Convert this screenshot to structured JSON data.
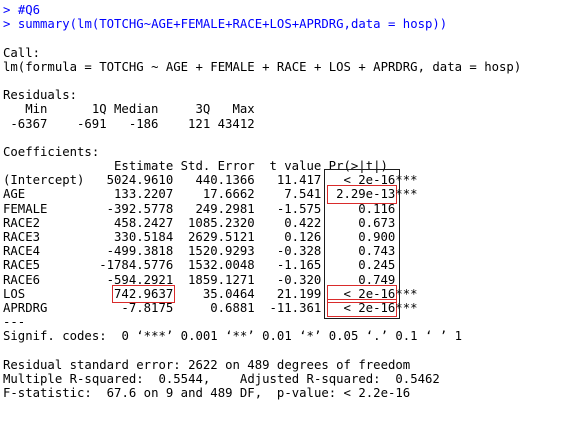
{
  "console": {
    "comment": "#Q6",
    "command": "summary(lm(TOTCHG~AGE+FEMALE+RACE+LOS+APRDRG,data = hosp))",
    "prompt_char": ">"
  },
  "call": {
    "header": "Call:",
    "formula": "lm(formula = TOTCHG ~ AGE + FEMALE + RACE + LOS + APRDRG, data = hosp)"
  },
  "residuals": {
    "header": "Residuals:",
    "labels": [
      "Min",
      "1Q",
      "Median",
      "3Q",
      "Max"
    ],
    "values": [
      "-6367",
      "-691",
      "-186",
      "121",
      "43412"
    ]
  },
  "coefficients": {
    "header": "Coefficients:",
    "columns": [
      "Estimate",
      "Std. Error",
      "t value",
      "Pr(>|t|)"
    ],
    "rows": [
      {
        "name": "(Intercept)",
        "estimate": "5024.9610",
        "se": "440.1366",
        "t": "11.417",
        "p": "< 2e-16",
        "stars": "***"
      },
      {
        "name": "AGE",
        "estimate": "133.2207",
        "se": "17.6662",
        "t": "7.541",
        "p": "2.29e-13",
        "stars": "***"
      },
      {
        "name": "FEMALE",
        "estimate": "-392.5778",
        "se": "249.2981",
        "t": "-1.575",
        "p": "0.116",
        "stars": ""
      },
      {
        "name": "RACE2",
        "estimate": "458.2427",
        "se": "1085.2320",
        "t": "0.422",
        "p": "0.673",
        "stars": ""
      },
      {
        "name": "RACE3",
        "estimate": "330.5184",
        "se": "2629.5121",
        "t": "0.126",
        "p": "0.900",
        "stars": ""
      },
      {
        "name": "RACE4",
        "estimate": "-499.3818",
        "se": "1520.9293",
        "t": "-0.328",
        "p": "0.743",
        "stars": ""
      },
      {
        "name": "RACE5",
        "estimate": "-1784.5776",
        "se": "1532.0048",
        "t": "-1.165",
        "p": "0.245",
        "stars": ""
      },
      {
        "name": "RACE6",
        "estimate": "-594.2921",
        "se": "1859.1271",
        "t": "-0.320",
        "p": "0.749",
        "stars": ""
      },
      {
        "name": "LOS",
        "estimate": "742.9637",
        "se": "35.0464",
        "t": "21.199",
        "p": "< 2e-16",
        "stars": "***"
      },
      {
        "name": "APRDRG",
        "estimate": "-7.8175",
        "se": "0.6881",
        "t": "-11.361",
        "p": "< 2e-16",
        "stars": "***"
      }
    ],
    "separator": "---",
    "signif_codes": "Signif. codes:  0 ‘***’ 0.001 ‘**’ 0.01 ‘*’ 0.05 ‘.’ 0.1 ‘ ’ 1"
  },
  "summary": {
    "residual_se": "Residual standard error: 2622 on 489 degrees of freedom",
    "r_squared": "Multiple R-squared:  0.5544,\tAdjusted R-squared:  0.5462 ",
    "f_statistic": "F-statistic:  67.6 on 9 and 489 DF,  p-value: < 2.2e-16"
  },
  "highlights": {
    "red_box_color": "#d92b2b",
    "black_box_color": "#1b1b1b",
    "red_boxed_cells": [
      "AGE.p",
      "LOS.estimate",
      "LOS.p",
      "APRDRG.p"
    ]
  }
}
